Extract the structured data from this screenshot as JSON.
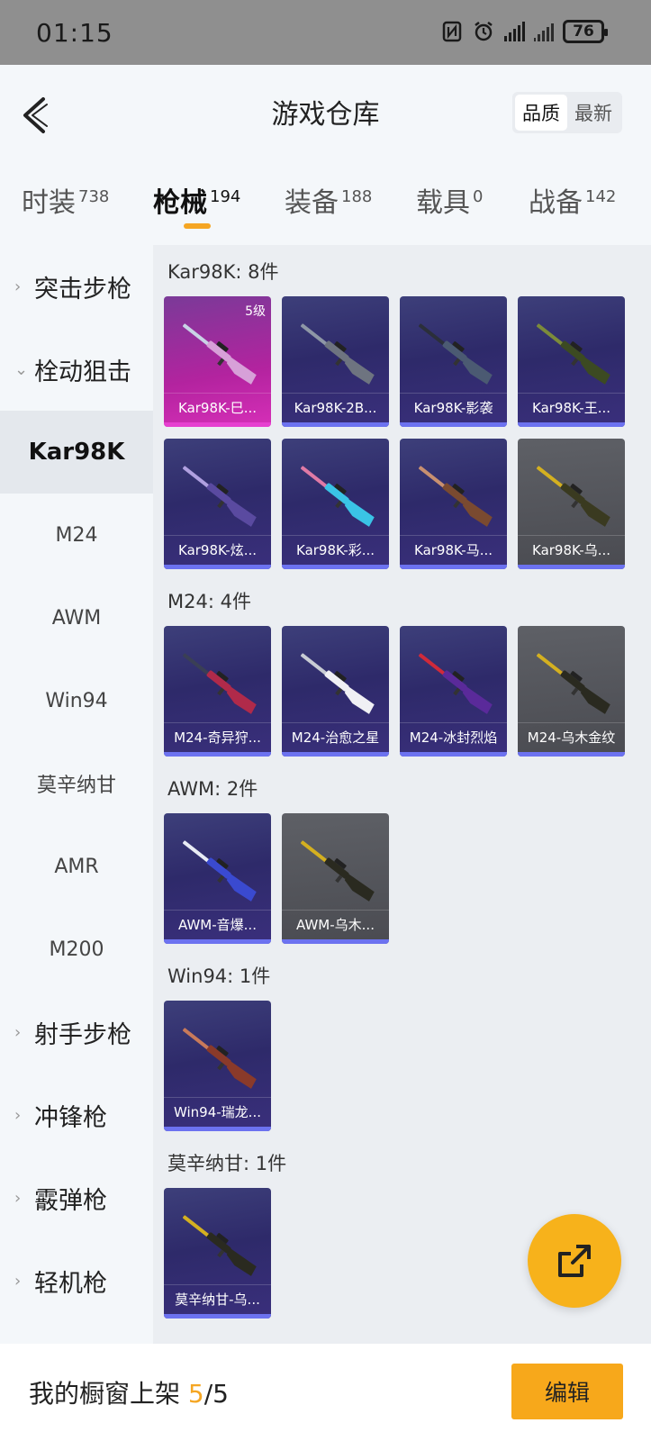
{
  "status_bar": {
    "time": "01:15",
    "battery": "76"
  },
  "header": {
    "title": "游戏仓库",
    "sort_options": [
      "品质",
      "最新"
    ]
  },
  "tabs": [
    {
      "label": "时装",
      "count": "738"
    },
    {
      "label": "枪械",
      "count": "194"
    },
    {
      "label": "装备",
      "count": "188"
    },
    {
      "label": "载具",
      "count": "0"
    },
    {
      "label": "战备",
      "count": "142"
    }
  ],
  "sidebar": {
    "items": [
      {
        "label": "突击步枪",
        "type": "category",
        "arrow": "›"
      },
      {
        "label": "栓动狙击",
        "type": "category",
        "arrow": "⌄"
      },
      {
        "label": "Kar98K",
        "type": "selected"
      },
      {
        "label": "M24",
        "type": "sub"
      },
      {
        "label": "AWM",
        "type": "sub"
      },
      {
        "label": "Win94",
        "type": "sub"
      },
      {
        "label": "莫辛纳甘",
        "type": "sub"
      },
      {
        "label": "AMR",
        "type": "sub"
      },
      {
        "label": "M200",
        "type": "sub"
      },
      {
        "label": "射手步枪",
        "type": "category",
        "arrow": "›"
      },
      {
        "label": "冲锋枪",
        "type": "category",
        "arrow": "›"
      },
      {
        "label": "霰弹枪",
        "type": "category",
        "arrow": "›"
      },
      {
        "label": "轻机枪",
        "type": "category",
        "arrow": "›"
      }
    ]
  },
  "sections": [
    {
      "title": "Kar98K: 8件",
      "items": [
        {
          "label": "Kar98K-巳...",
          "level": "5级",
          "style": "pink"
        },
        {
          "label": "Kar98K-2B...",
          "style": "purple"
        },
        {
          "label": "Kar98K-影袭",
          "style": "purple"
        },
        {
          "label": "Kar98K-王...",
          "style": "purple"
        },
        {
          "label": "Kar98K-炫...",
          "style": "purple"
        },
        {
          "label": "Kar98K-彩...",
          "style": "purple"
        },
        {
          "label": "Kar98K-马...",
          "style": "purple"
        },
        {
          "label": "Kar98K-乌...",
          "style": "gray"
        }
      ]
    },
    {
      "title": "M24: 4件",
      "items": [
        {
          "label": "M24-奇异狩...",
          "style": "purple"
        },
        {
          "label": "M24-治愈之星",
          "style": "purple"
        },
        {
          "label": "M24-冰封烈焰",
          "style": "purple"
        },
        {
          "label": "M24-乌木金纹",
          "style": "gray"
        }
      ]
    },
    {
      "title": "AWM: 2件",
      "items": [
        {
          "label": "AWM-音爆...",
          "style": "purple"
        },
        {
          "label": "AWM-乌木...",
          "style": "gray"
        }
      ]
    },
    {
      "title": "Win94: 1件",
      "items": [
        {
          "label": "Win94-瑞龙...",
          "style": "purple"
        }
      ]
    },
    {
      "title": "莫辛纳甘: 1件",
      "items": [
        {
          "label": "莫辛纳甘-乌...",
          "style": "purple"
        }
      ]
    }
  ],
  "bottom_bar": {
    "prefix": "我的橱窗上架 ",
    "current": "5",
    "total": "/5",
    "edit_label": "编辑"
  },
  "fab_icon": "share-external-icon",
  "colors": {
    "accent": "#f7a81b",
    "card_bar": "#6c72f0"
  }
}
